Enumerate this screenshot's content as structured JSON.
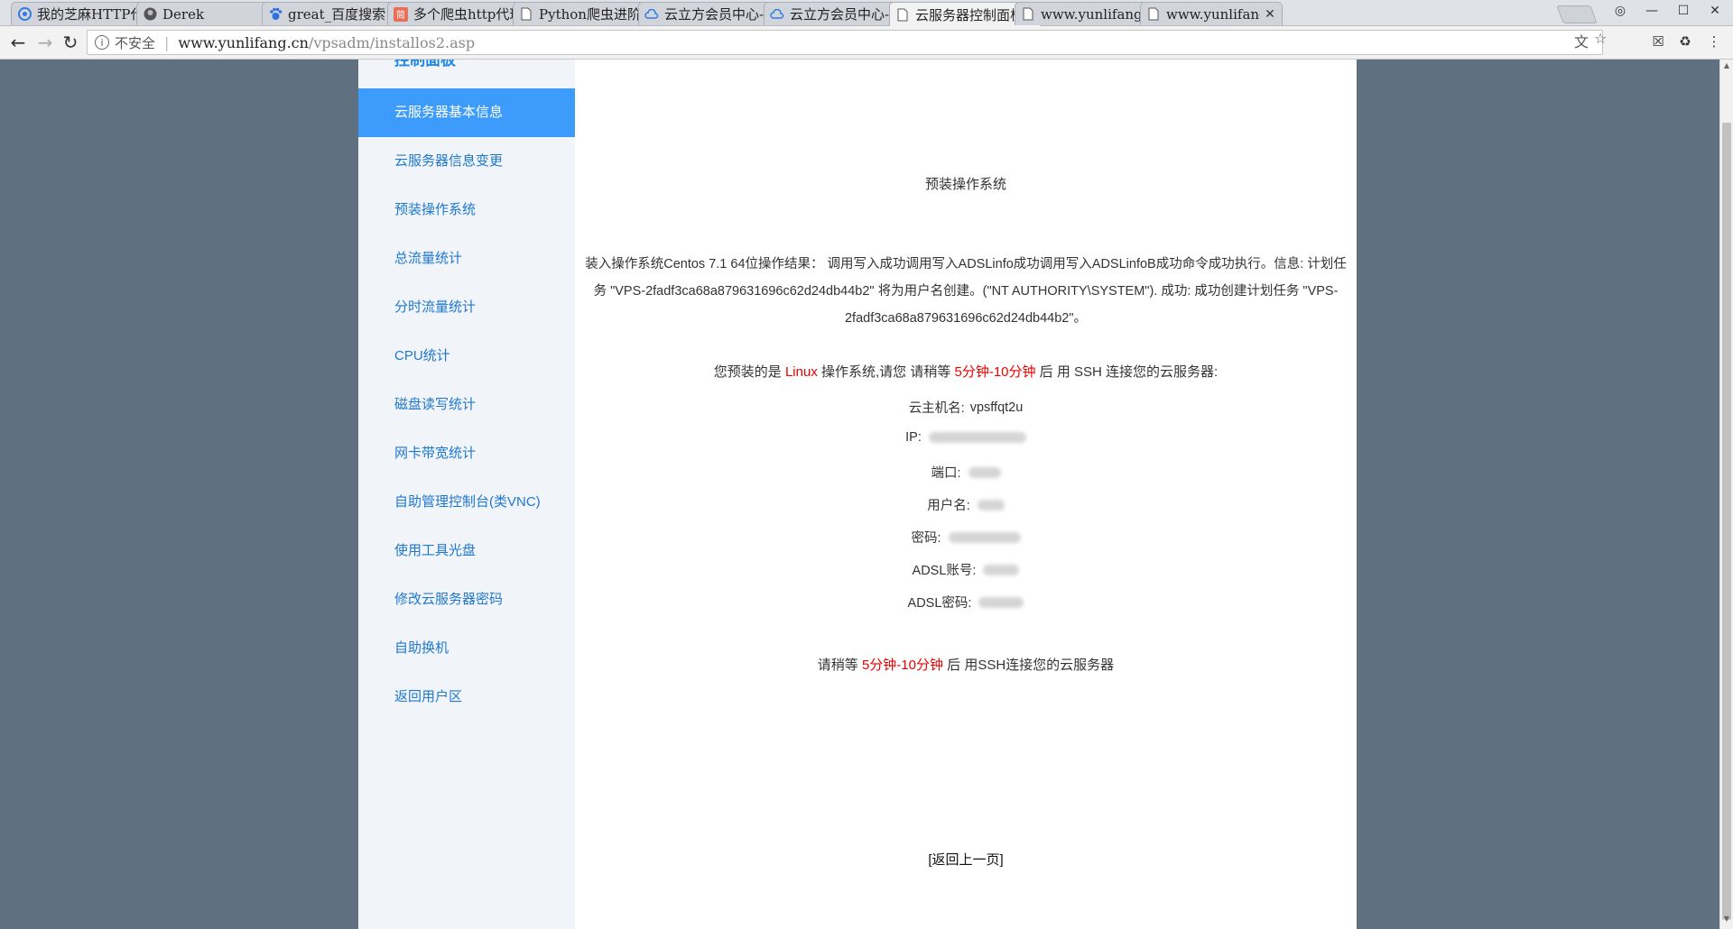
{
  "browser": {
    "tabs": [
      {
        "title": "我的芝麻HTTP代理",
        "icon": "sesame-icon"
      },
      {
        "title": "Derek",
        "icon": "avatar-icon"
      },
      {
        "title": "great_百度搜索",
        "icon": "baidu-icon"
      },
      {
        "title": "多个爬虫http代理",
        "icon": "jianshu-icon"
      },
      {
        "title": "Python爬虫进阶",
        "icon": "page-icon"
      },
      {
        "title": "云立方会员中心-",
        "icon": "cloud-icon"
      },
      {
        "title": "云立方会员中心-",
        "icon": "cloud-icon"
      },
      {
        "title": "云服务器控制面板",
        "icon": "page-icon"
      },
      {
        "title": "www.yunlifang.c",
        "icon": "page-icon"
      },
      {
        "title": "www.yunlifang.c",
        "icon": "page-icon"
      }
    ],
    "insecure_label": "不安全",
    "url_host": "www.yunlifang.cn",
    "url_path": "/vpsadm/installos2.asp"
  },
  "sidebar": {
    "heading": "控制面板",
    "items": [
      {
        "label": "云服务器基本信息",
        "active": true
      },
      {
        "label": "云服务器信息变更"
      },
      {
        "label": "预装操作系统"
      },
      {
        "label": "总流量统计"
      },
      {
        "label": "分时流量统计"
      },
      {
        "label": "CPU统计"
      },
      {
        "label": "磁盘读写统计"
      },
      {
        "label": "网卡带宽统计"
      },
      {
        "label": "自助管理控制台(类VNC)"
      },
      {
        "label": "使用工具光盘"
      },
      {
        "label": "修改云服务器密码"
      },
      {
        "label": "自助换机"
      },
      {
        "label": "返回用户区"
      }
    ]
  },
  "content": {
    "title": "预装操作系统",
    "result_text": "装入操作系统Centos 7.1 64位操作结果： 调用写入成功调用写入ADSLinfo成功调用写入ADSLinfoB成功命令成功执行。信息: 计划任务 \"VPS-2fadf3ca68a879631696c62d24db44b2\" 将为用户名创建。(\"NT AUTHORITY\\SYSTEM\"). 成功: 成功创建计划任务 \"VPS-2fadf3ca68a879631696c62d24db44b2\"。",
    "notice_pre": "您预装的是 ",
    "notice_os": "Linux",
    "notice_mid": " 操作系统,请您 请稍等 ",
    "notice_wait": "5分钟-10分钟",
    "notice_post": " 后 用 SSH 连接您的云服务器:",
    "fields": [
      {
        "label": "云主机名:",
        "value": "vpsffqt2u"
      },
      {
        "label": "IP:",
        "value": ""
      },
      {
        "label": "端口:",
        "value": ""
      },
      {
        "label": "用户名:",
        "value": ""
      },
      {
        "label": "密码:",
        "value": ""
      },
      {
        "label": "ADSL账号:",
        "value": ""
      },
      {
        "label": "ADSL密码:",
        "value": ""
      }
    ],
    "wait_pre": "请稍等 ",
    "wait_time": "5分钟-10分钟",
    "wait_post": " 后 用SSH连接您的云服务器",
    "back_link": "[返回上一页]"
  }
}
